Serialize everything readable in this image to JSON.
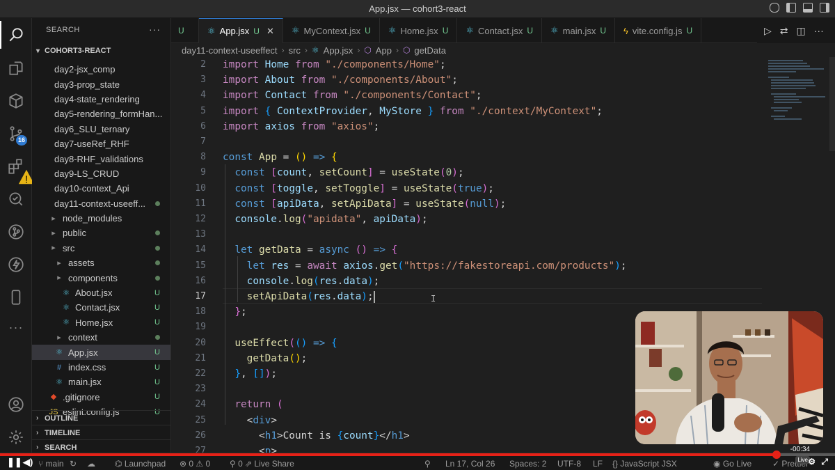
{
  "window": {
    "title": "App.jsx — cohort3-react"
  },
  "activity": {
    "scm_badge": "16"
  },
  "sidebar": {
    "header": "SEARCH",
    "project": "COHORT3-REACT",
    "items": [
      {
        "label": "day2-jsx_comp",
        "icon": "folder",
        "indent": 0,
        "status": ""
      },
      {
        "label": "day3-prop_state",
        "icon": "folder",
        "indent": 0,
        "status": ""
      },
      {
        "label": "day4-state_rendering",
        "icon": "folder",
        "indent": 0,
        "status": ""
      },
      {
        "label": "day5-rendering_formHan...",
        "icon": "folder",
        "indent": 0,
        "status": ""
      },
      {
        "label": "day6_SLU_ternary",
        "icon": "folder",
        "indent": 0,
        "status": ""
      },
      {
        "label": "day7-useRef_RHF",
        "icon": "folder",
        "indent": 0,
        "status": ""
      },
      {
        "label": "day8-RHF_validations",
        "icon": "folder",
        "indent": 0,
        "status": ""
      },
      {
        "label": "day9-LS_CRUD",
        "icon": "folder",
        "indent": 0,
        "status": ""
      },
      {
        "label": "day10-context_Api",
        "icon": "folder",
        "indent": 0,
        "status": ""
      },
      {
        "label": "day11-context-useeff...",
        "icon": "folder",
        "indent": 0,
        "status": "dot"
      },
      {
        "label": "node_modules",
        "icon": "folder",
        "indent": 1,
        "status": ""
      },
      {
        "label": "public",
        "icon": "folder",
        "indent": 1,
        "status": "dot"
      },
      {
        "label": "src",
        "icon": "folder",
        "indent": 1,
        "status": "dot"
      },
      {
        "label": "assets",
        "icon": "folder",
        "indent": 2,
        "status": "dot"
      },
      {
        "label": "components",
        "icon": "folder",
        "indent": 2,
        "status": "dot"
      },
      {
        "label": "About.jsx",
        "icon": "react",
        "indent": 3,
        "status": "U"
      },
      {
        "label": "Contact.jsx",
        "icon": "react",
        "indent": 3,
        "status": "U"
      },
      {
        "label": "Home.jsx",
        "icon": "react",
        "indent": 3,
        "status": "U"
      },
      {
        "label": "context",
        "icon": "folder",
        "indent": 2,
        "status": "dot"
      },
      {
        "label": "App.jsx",
        "icon": "react",
        "indent": 2,
        "status": "U",
        "selected": true
      },
      {
        "label": "index.css",
        "icon": "css",
        "indent": 2,
        "status": "U"
      },
      {
        "label": "main.jsx",
        "icon": "react",
        "indent": 2,
        "status": "U"
      },
      {
        "label": ".gitignore",
        "icon": "git",
        "indent": 1,
        "status": "U"
      },
      {
        "label": "eslint.config.js",
        "icon": "js",
        "indent": 1,
        "status": "U"
      }
    ],
    "sections": [
      "OUTLINE",
      "TIMELINE",
      "SEARCH"
    ]
  },
  "tabs": [
    {
      "label": "",
      "status": "U",
      "icon": ""
    },
    {
      "label": "App.jsx",
      "status": "U",
      "icon": "react",
      "active": true
    },
    {
      "label": "MyContext.jsx",
      "status": "U",
      "icon": "react"
    },
    {
      "label": "Home.jsx",
      "status": "U",
      "icon": "react"
    },
    {
      "label": "Contact.jsx",
      "status": "U",
      "icon": "react"
    },
    {
      "label": "main.jsx",
      "status": "U",
      "icon": "react"
    },
    {
      "label": "vite.config.js",
      "status": "U",
      "icon": "vite"
    }
  ],
  "breadcrumb": [
    "day11-context-useeffect",
    "src",
    "App.jsx",
    "App",
    "getData"
  ],
  "editor": {
    "first_line": 2,
    "current_line": 17,
    "lines": [
      [
        [
          "kw",
          "import"
        ],
        [
          "t",
          " "
        ],
        [
          "v",
          "Home"
        ],
        [
          "t",
          " "
        ],
        [
          "kw",
          "from"
        ],
        [
          "t",
          " "
        ],
        [
          "s",
          "\"./components/Home\""
        ],
        [
          "t",
          ";"
        ]
      ],
      [
        [
          "kw",
          "import"
        ],
        [
          "t",
          " "
        ],
        [
          "v",
          "About"
        ],
        [
          "t",
          " "
        ],
        [
          "kw",
          "from"
        ],
        [
          "t",
          " "
        ],
        [
          "s",
          "\"./components/About\""
        ],
        [
          "t",
          ";"
        ]
      ],
      [
        [
          "kw",
          "import"
        ],
        [
          "t",
          " "
        ],
        [
          "v",
          "Contact"
        ],
        [
          "t",
          " "
        ],
        [
          "kw",
          "from"
        ],
        [
          "t",
          " "
        ],
        [
          "s",
          "\"./components/Contact\""
        ],
        [
          "t",
          ";"
        ]
      ],
      [
        [
          "kw",
          "import"
        ],
        [
          "t",
          " "
        ],
        [
          "p3",
          "{"
        ],
        [
          "t",
          " "
        ],
        [
          "v",
          "ContextProvider"
        ],
        [
          "t",
          ", "
        ],
        [
          "v",
          "MyStore"
        ],
        [
          "t",
          " "
        ],
        [
          "p3",
          "}"
        ],
        [
          "t",
          " "
        ],
        [
          "kw",
          "from"
        ],
        [
          "t",
          " "
        ],
        [
          "s",
          "\"./context/MyContext\""
        ],
        [
          "t",
          ";"
        ]
      ],
      [
        [
          "kw",
          "import"
        ],
        [
          "t",
          " "
        ],
        [
          "v",
          "axios"
        ],
        [
          "t",
          " "
        ],
        [
          "kw",
          "from"
        ],
        [
          "t",
          " "
        ],
        [
          "s",
          "\"axios\""
        ],
        [
          "t",
          ";"
        ]
      ],
      [],
      [
        [
          "k",
          "const"
        ],
        [
          "t",
          " "
        ],
        [
          "f",
          "App"
        ],
        [
          "t",
          " = "
        ],
        [
          "p",
          "()"
        ],
        [
          "t",
          " "
        ],
        [
          "k",
          "=>"
        ],
        [
          "t",
          " "
        ],
        [
          "p",
          "{"
        ]
      ],
      [
        [
          "t",
          "  "
        ],
        [
          "k",
          "const"
        ],
        [
          "t",
          " "
        ],
        [
          "p2",
          "["
        ],
        [
          "v",
          "count"
        ],
        [
          "t",
          ", "
        ],
        [
          "f",
          "setCount"
        ],
        [
          "p2",
          "]"
        ],
        [
          "t",
          " = "
        ],
        [
          "f",
          "useState"
        ],
        [
          "p2",
          "("
        ],
        [
          "n",
          "0"
        ],
        [
          "p2",
          ")"
        ],
        [
          "t",
          ";"
        ]
      ],
      [
        [
          "t",
          "  "
        ],
        [
          "k",
          "const"
        ],
        [
          "t",
          " "
        ],
        [
          "p2",
          "["
        ],
        [
          "v",
          "toggle"
        ],
        [
          "t",
          ", "
        ],
        [
          "f",
          "setToggle"
        ],
        [
          "p2",
          "]"
        ],
        [
          "t",
          " = "
        ],
        [
          "f",
          "useState"
        ],
        [
          "p2",
          "("
        ],
        [
          "k",
          "true"
        ],
        [
          "p2",
          ")"
        ],
        [
          "t",
          ";"
        ]
      ],
      [
        [
          "t",
          "  "
        ],
        [
          "k",
          "const"
        ],
        [
          "t",
          " "
        ],
        [
          "p2",
          "["
        ],
        [
          "v",
          "apiData"
        ],
        [
          "t",
          ", "
        ],
        [
          "f",
          "setApiData"
        ],
        [
          "p2",
          "]"
        ],
        [
          "t",
          " = "
        ],
        [
          "f",
          "useState"
        ],
        [
          "p2",
          "("
        ],
        [
          "k",
          "null"
        ],
        [
          "p2",
          ")"
        ],
        [
          "t",
          ";"
        ]
      ],
      [
        [
          "t",
          "  "
        ],
        [
          "v",
          "console"
        ],
        [
          "t",
          "."
        ],
        [
          "f",
          "log"
        ],
        [
          "p2",
          "("
        ],
        [
          "s",
          "\"apidata\""
        ],
        [
          "t",
          ", "
        ],
        [
          "v",
          "apiData"
        ],
        [
          "p2",
          ")"
        ],
        [
          "t",
          ";"
        ]
      ],
      [],
      [
        [
          "t",
          "  "
        ],
        [
          "k",
          "let"
        ],
        [
          "t",
          " "
        ],
        [
          "f",
          "getData"
        ],
        [
          "t",
          " = "
        ],
        [
          "k",
          "async"
        ],
        [
          "t",
          " "
        ],
        [
          "p2",
          "()"
        ],
        [
          "t",
          " "
        ],
        [
          "k",
          "=>"
        ],
        [
          "t",
          " "
        ],
        [
          "p2",
          "{"
        ]
      ],
      [
        [
          "t",
          "    "
        ],
        [
          "k",
          "let"
        ],
        [
          "t",
          " "
        ],
        [
          "v",
          "res"
        ],
        [
          "t",
          " = "
        ],
        [
          "kw",
          "await"
        ],
        [
          "t",
          " "
        ],
        [
          "v",
          "axios"
        ],
        [
          "t",
          "."
        ],
        [
          "f",
          "get"
        ],
        [
          "p3",
          "("
        ],
        [
          "s",
          "\"https://fakestoreapi.com/products\""
        ],
        [
          "p3",
          ")"
        ],
        [
          "t",
          ";"
        ]
      ],
      [
        [
          "t",
          "    "
        ],
        [
          "v",
          "console"
        ],
        [
          "t",
          "."
        ],
        [
          "f",
          "log"
        ],
        [
          "p3",
          "("
        ],
        [
          "v",
          "res"
        ],
        [
          "t",
          "."
        ],
        [
          "v",
          "data"
        ],
        [
          "p3",
          ")"
        ],
        [
          "t",
          ";"
        ]
      ],
      [
        [
          "t",
          "    "
        ],
        [
          "f",
          "setApiData"
        ],
        [
          "p3",
          "("
        ],
        [
          "v",
          "res"
        ],
        [
          "t",
          "."
        ],
        [
          "v",
          "data"
        ],
        [
          "p3",
          ")"
        ],
        [
          "t",
          ";"
        ],
        [
          "cursor",
          ""
        ]
      ],
      [
        [
          "t",
          "  "
        ],
        [
          "p2",
          "}"
        ],
        [
          "t",
          ";"
        ]
      ],
      [],
      [
        [
          "t",
          "  "
        ],
        [
          "f",
          "useEffect"
        ],
        [
          "p2",
          "("
        ],
        [
          "p3",
          "()"
        ],
        [
          "t",
          " "
        ],
        [
          "k",
          "=>"
        ],
        [
          "t",
          " "
        ],
        [
          "p3",
          "{"
        ]
      ],
      [
        [
          "t",
          "    "
        ],
        [
          "f",
          "getData"
        ],
        [
          "p",
          "()"
        ],
        [
          "t",
          ";"
        ]
      ],
      [
        [
          "t",
          "  "
        ],
        [
          "p3",
          "}"
        ],
        [
          "t",
          ", "
        ],
        [
          "p3",
          "[]"
        ],
        [
          "p2",
          ")"
        ],
        [
          "t",
          ";"
        ]
      ],
      [],
      [
        [
          "t",
          "  "
        ],
        [
          "kw",
          "return"
        ],
        [
          "t",
          " "
        ],
        [
          "p2",
          "("
        ]
      ],
      [
        [
          "t",
          "    "
        ],
        [
          "t",
          "<"
        ],
        [
          "k",
          "div"
        ],
        [
          "t",
          ">"
        ]
      ],
      [
        [
          "t",
          "      "
        ],
        [
          "t",
          "<"
        ],
        [
          "k",
          "h1"
        ],
        [
          "t",
          ">Count is "
        ],
        [
          "p3",
          "{"
        ],
        [
          "v",
          "count"
        ],
        [
          "p3",
          "}"
        ],
        [
          "t",
          "</"
        ],
        [
          "k",
          "h1"
        ],
        [
          "t",
          ">"
        ]
      ],
      [
        [
          "t",
          "      "
        ],
        [
          "t",
          "<"
        ],
        [
          "k",
          "p"
        ],
        [
          "t",
          ">"
        ]
      ]
    ]
  },
  "statusbar": {
    "branch": "main",
    "launchpad": "Launchpad",
    "problems": "0",
    "warnings": "0",
    "liveshare": "Live Share",
    "position": "Ln 17, Col 26",
    "spaces": "Spaces: 2",
    "encoding": "UTF-8",
    "eol": "LF",
    "language": "JavaScript JSX",
    "golive": "Go Live",
    "prettier": "Prettier",
    "time": "-00:34",
    "live": "Live",
    "video_progress": 0.93
  }
}
